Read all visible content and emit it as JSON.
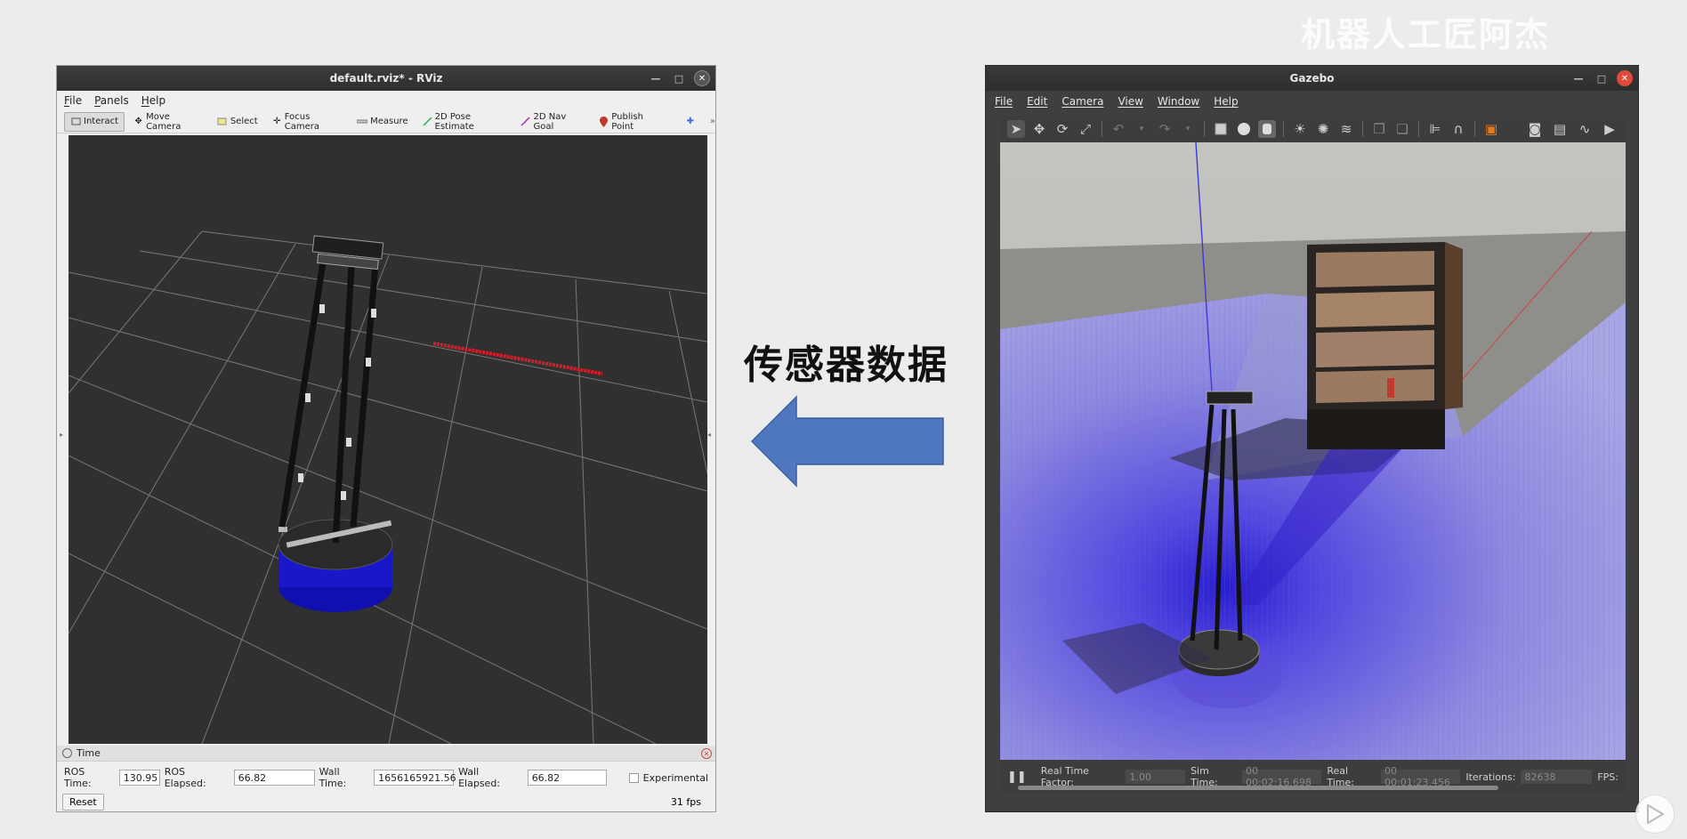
{
  "watermark": "机器人工匠阿杰",
  "rviz": {
    "title": "default.rviz* - RViz",
    "menu": [
      "File",
      "Panels",
      "Help"
    ],
    "tools": [
      {
        "label": "Interact",
        "icon": "cursor-icon"
      },
      {
        "label": "Move Camera",
        "icon": "move-camera-icon"
      },
      {
        "label": "Select",
        "icon": "select-icon"
      },
      {
        "label": "Focus Camera",
        "icon": "focus-camera-icon"
      },
      {
        "label": "Measure",
        "icon": "measure-icon"
      },
      {
        "label": "2D Pose Estimate",
        "icon": "pose-estimate-icon"
      },
      {
        "label": "2D Nav Goal",
        "icon": "nav-goal-icon"
      },
      {
        "label": "Publish Point",
        "icon": "publish-point-icon"
      }
    ],
    "time_panel": {
      "title": "Time",
      "ros_time_label": "ROS Time:",
      "ros_time": "130.95",
      "ros_elapsed_label": "ROS Elapsed:",
      "ros_elapsed": "66.82",
      "wall_time_label": "Wall Time:",
      "wall_time": "1656165921.56",
      "wall_elapsed_label": "Wall Elapsed:",
      "wall_elapsed": "66.82",
      "experimental_label": "Experimental",
      "reset_label": "Reset",
      "fps": "31 fps"
    }
  },
  "middle": {
    "label": "传感器数据",
    "arrow_color": "#4f78bf"
  },
  "gazebo": {
    "title": "Gazebo",
    "menu": [
      "File",
      "Edit",
      "Camera",
      "View",
      "Window",
      "Help"
    ],
    "status": {
      "rtf_label": "Real Time Factor:",
      "rtf": "1.00",
      "sim_label": "Sim Time:",
      "sim": "00 00:02:16.698",
      "real_label": "Real Time:",
      "real": "00 00:01:23.456",
      "iter_label": "Iterations:",
      "iter": "82638",
      "fps_label": "FPS:"
    },
    "laser_color": "#5a50e6"
  }
}
